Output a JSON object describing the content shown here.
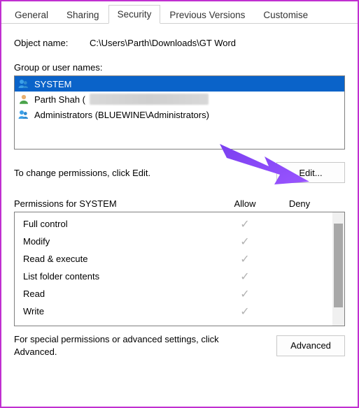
{
  "tabs": {
    "general": "General",
    "sharing": "Sharing",
    "security": "Security",
    "previous": "Previous Versions",
    "customise": "Customise"
  },
  "object": {
    "label": "Object name:",
    "value": "C:\\Users\\Parth\\Downloads\\GT Word"
  },
  "groups": {
    "label": "Group or user names:",
    "items": [
      {
        "name": "SYSTEM",
        "icon": "group",
        "selected": true
      },
      {
        "name": "Parth Shah (",
        "icon": "user",
        "selected": false,
        "blurred": true
      },
      {
        "name": "Administrators (BLUEWINE\\Administrators)",
        "icon": "group",
        "selected": false
      }
    ]
  },
  "edit": {
    "message": "To change permissions, click Edit.",
    "button": "Edit..."
  },
  "permissions": {
    "title": "Permissions for SYSTEM",
    "columns": {
      "allow": "Allow",
      "deny": "Deny"
    },
    "rows": [
      {
        "name": "Full control",
        "allow": true,
        "deny": false
      },
      {
        "name": "Modify",
        "allow": true,
        "deny": false
      },
      {
        "name": "Read & execute",
        "allow": true,
        "deny": false
      },
      {
        "name": "List folder contents",
        "allow": true,
        "deny": false
      },
      {
        "name": "Read",
        "allow": true,
        "deny": false
      },
      {
        "name": "Write",
        "allow": true,
        "deny": false
      }
    ]
  },
  "advanced": {
    "message": "For special permissions or advanced settings, click Advanced.",
    "button": "Advanced"
  },
  "glyphs": {
    "check": "✓"
  }
}
